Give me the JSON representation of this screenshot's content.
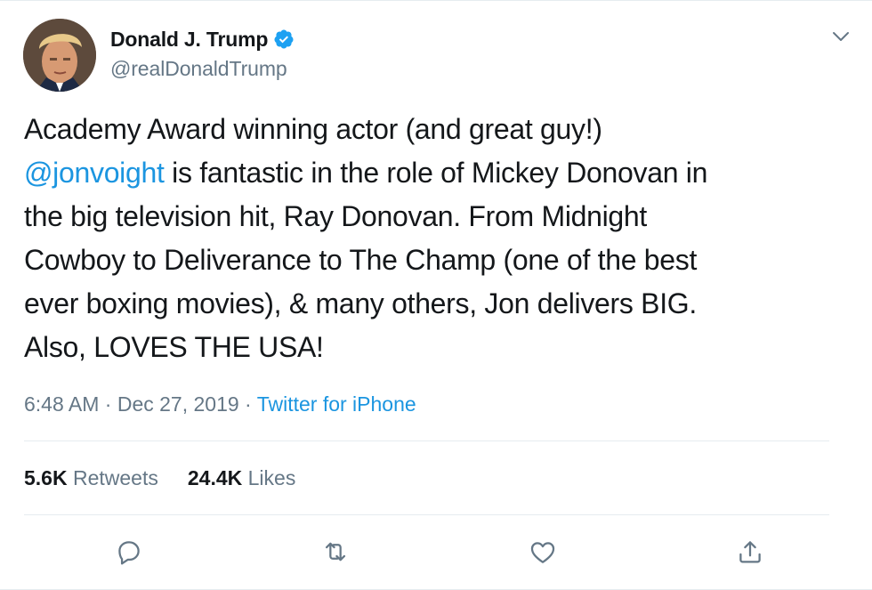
{
  "author": {
    "display_name": "Donald J. Trump",
    "handle": "@realDonaldTrump",
    "verified": true
  },
  "tweet": {
    "lines": [
      {
        "pre": "Academy Award winning actor (and great guy!)",
        "mention": "",
        "post": ""
      },
      {
        "pre": "",
        "mention": "@jonvoight",
        "post": " is fantastic in the role of Mickey Donovan in"
      },
      {
        "pre": "the big television hit, Ray Donovan. From Midnight",
        "mention": "",
        "post": ""
      },
      {
        "pre": "Cowboy to Deliverance to The Champ (one of the best",
        "mention": "",
        "post": ""
      },
      {
        "pre": "ever boxing movies), & many others, Jon delivers BIG.",
        "mention": "",
        "post": ""
      },
      {
        "pre": "Also, LOVES THE USA!",
        "mention": "",
        "post": ""
      }
    ]
  },
  "meta": {
    "time": "6:48 AM",
    "sep1": " · ",
    "date": "Dec 27, 2019",
    "sep2": " · ",
    "source": "Twitter for iPhone"
  },
  "stats": {
    "retweets_count": "5.6K",
    "retweets_label": " Retweets",
    "likes_count": "24.4K",
    "likes_label": " Likes"
  },
  "icons": {
    "verified": "verified-badge-icon",
    "more": "chevron-down-icon",
    "reply": "reply-icon",
    "retweet": "retweet-icon",
    "like": "heart-icon",
    "share": "share-icon"
  },
  "colors": {
    "link": "#1b95e0",
    "secondary_text": "#657786",
    "primary_text": "#14171a",
    "divider": "#e6ecf0"
  }
}
